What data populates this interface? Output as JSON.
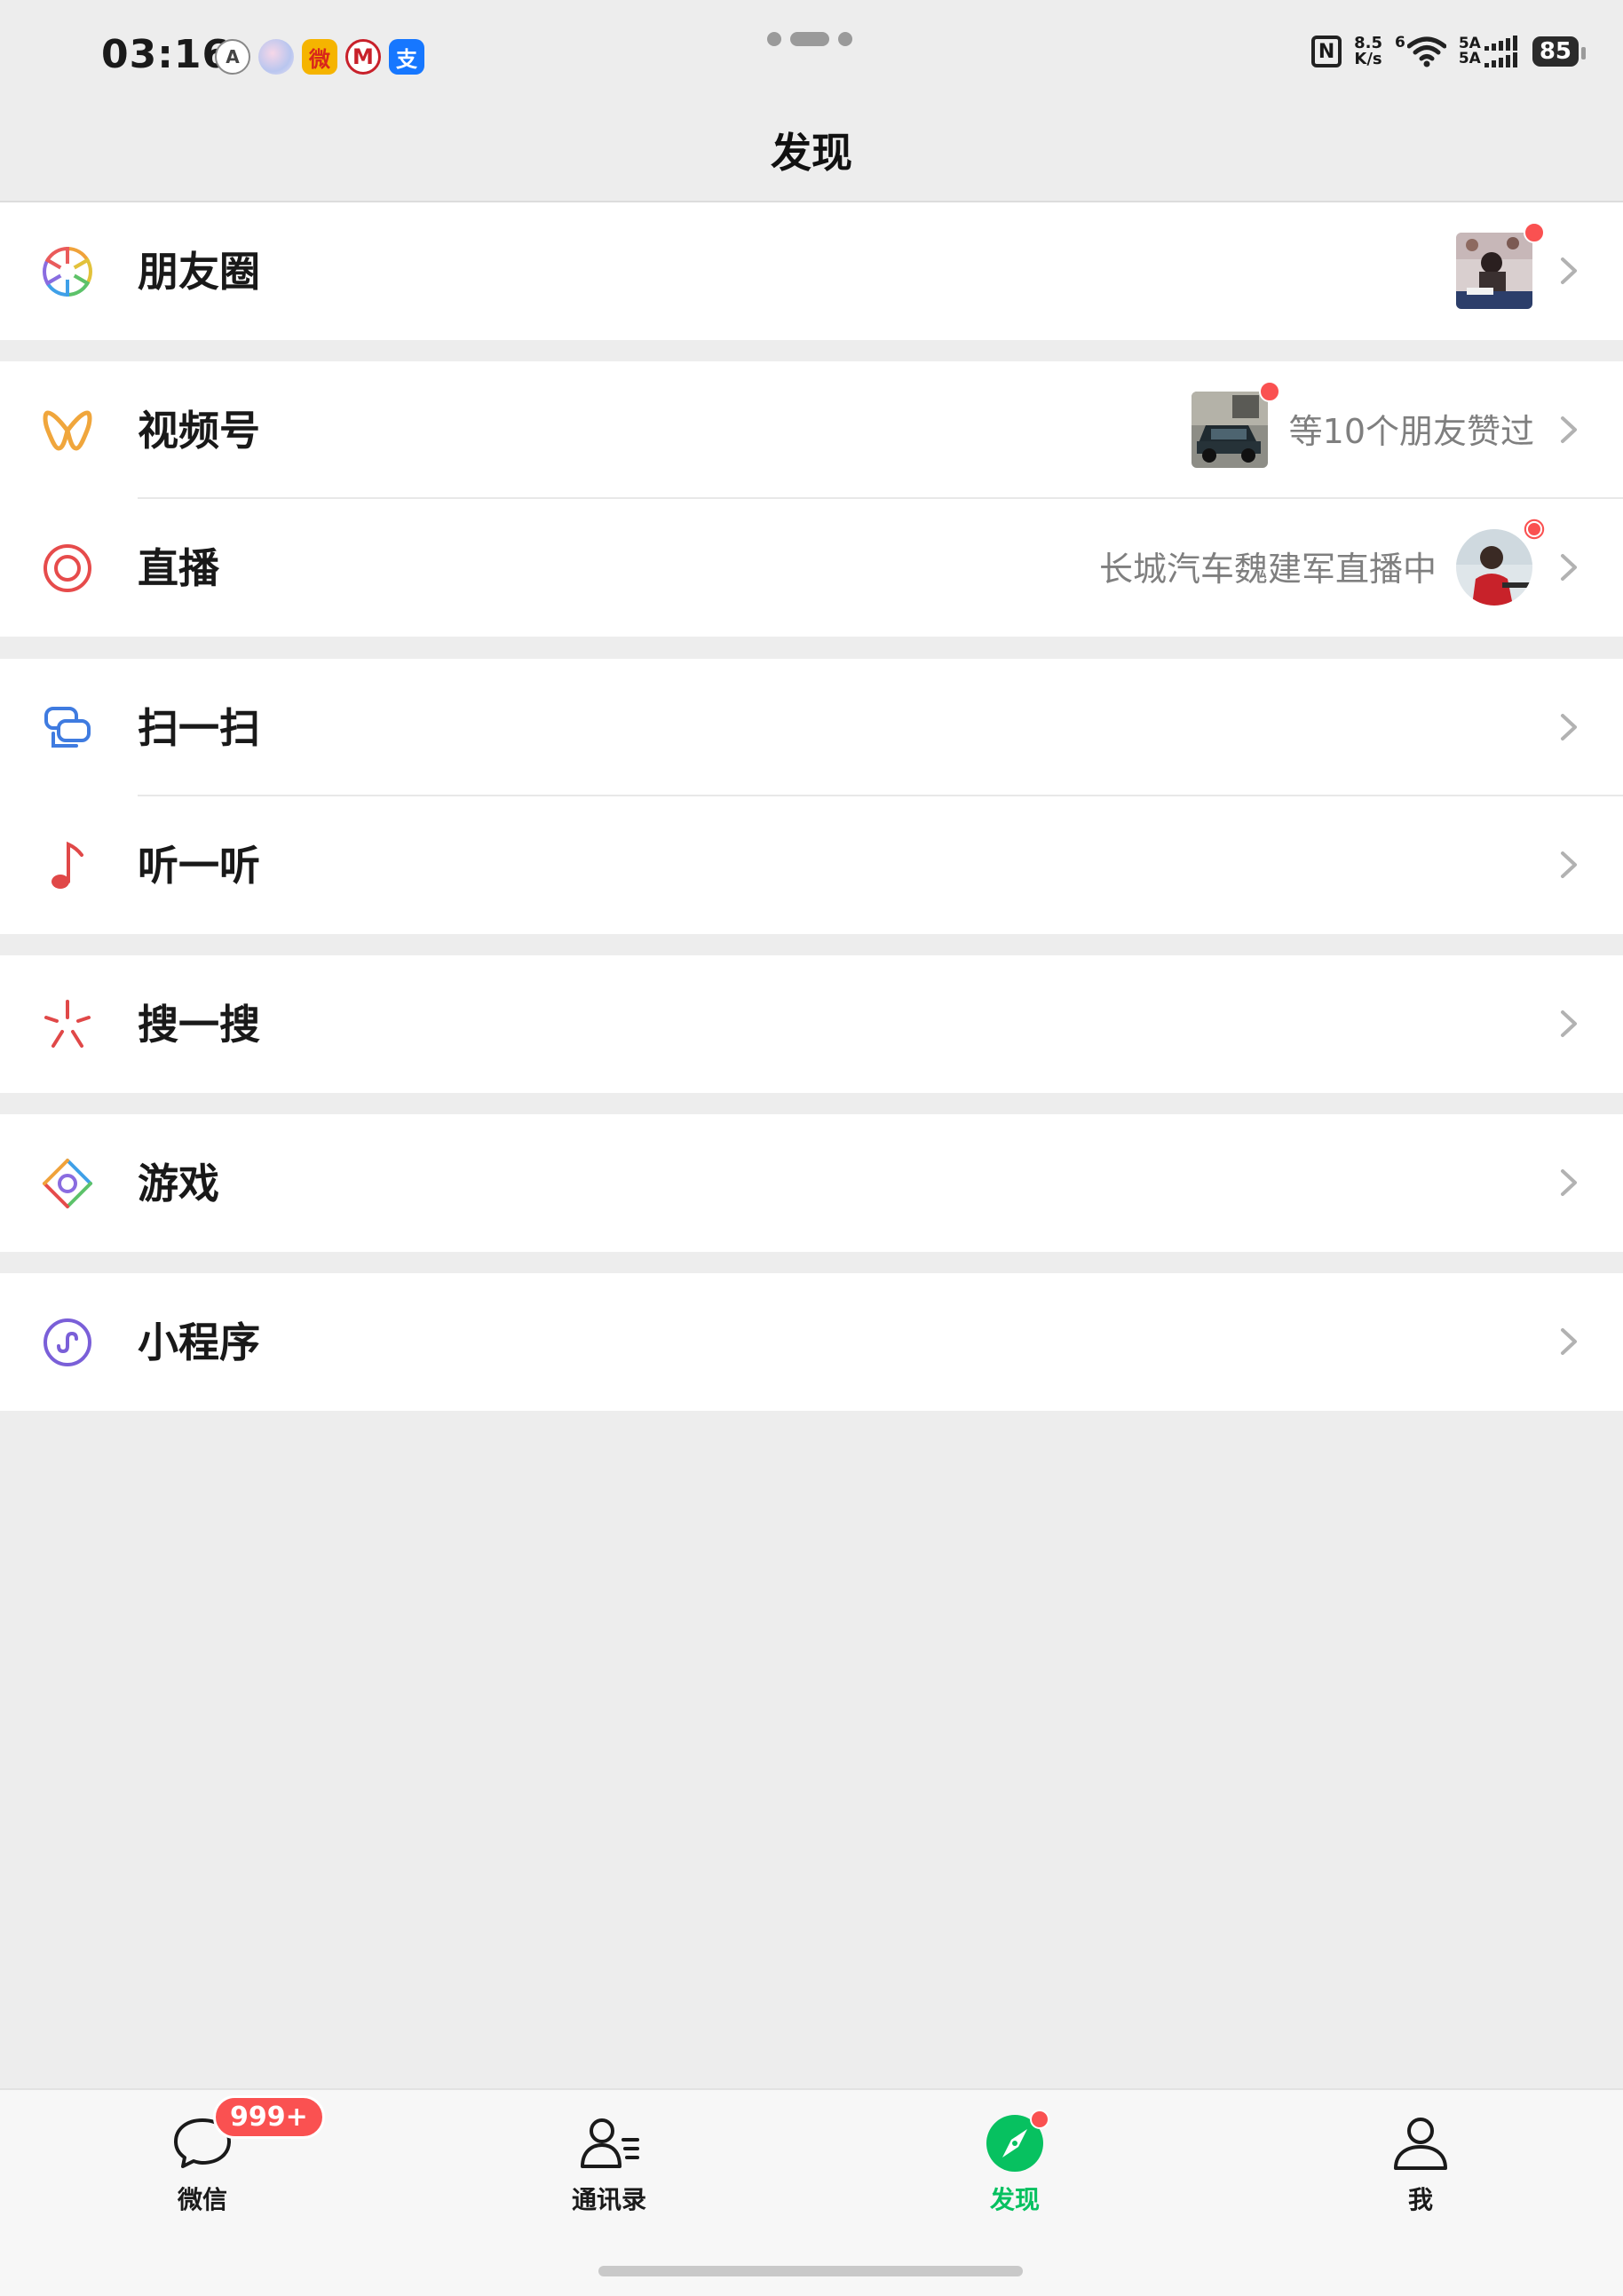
{
  "status_bar": {
    "time": "03:16",
    "notifications": [
      {
        "name": "app-notification-icon",
        "glyph": "A"
      },
      {
        "name": "assistant-notification-icon",
        "glyph": ""
      },
      {
        "name": "weibo-notification-icon",
        "glyph": "微"
      },
      {
        "name": "metro-notification-icon",
        "glyph": "M"
      },
      {
        "name": "alipay-notification-icon",
        "glyph": "支"
      }
    ],
    "nfc": "N",
    "net_speed_value": "8.5",
    "net_speed_unit": "K/s",
    "wifi_badge": "6",
    "signal_1": "5A",
    "signal_2": "5A",
    "battery": "85"
  },
  "header": {
    "title": "发现"
  },
  "menu": {
    "moments": {
      "label": "朋友圈",
      "icon": "moments-aperture-icon"
    },
    "channels": {
      "label": "视频号",
      "subtext": "等10个朋友赞过",
      "icon": "channels-butterfly-icon"
    },
    "live": {
      "label": "直播",
      "subtext": "长城汽车魏建军直播中",
      "icon": "live-target-icon"
    },
    "scan": {
      "label": "扫一扫",
      "icon": "scan-icon"
    },
    "listen": {
      "label": "听一听",
      "icon": "music-note-icon"
    },
    "search": {
      "label": "搜一搜",
      "icon": "search-sparkle-icon"
    },
    "games": {
      "label": "游戏",
      "icon": "games-diamond-icon"
    },
    "mini_programs": {
      "label": "小程序",
      "icon": "mini-program-icon"
    }
  },
  "tabbar": {
    "chats": {
      "label": "微信",
      "badge": "999+",
      "icon": "chat-bubble-icon"
    },
    "contacts": {
      "label": "通讯录",
      "icon": "contacts-icon"
    },
    "discover": {
      "label": "发现",
      "icon": "compass-icon",
      "active": true
    },
    "me": {
      "label": "我",
      "icon": "person-icon"
    }
  },
  "colors": {
    "accent_green": "#07c160",
    "badge_red": "#fa5151",
    "background": "#ededed",
    "secondary_text": "#7f7f7f"
  }
}
